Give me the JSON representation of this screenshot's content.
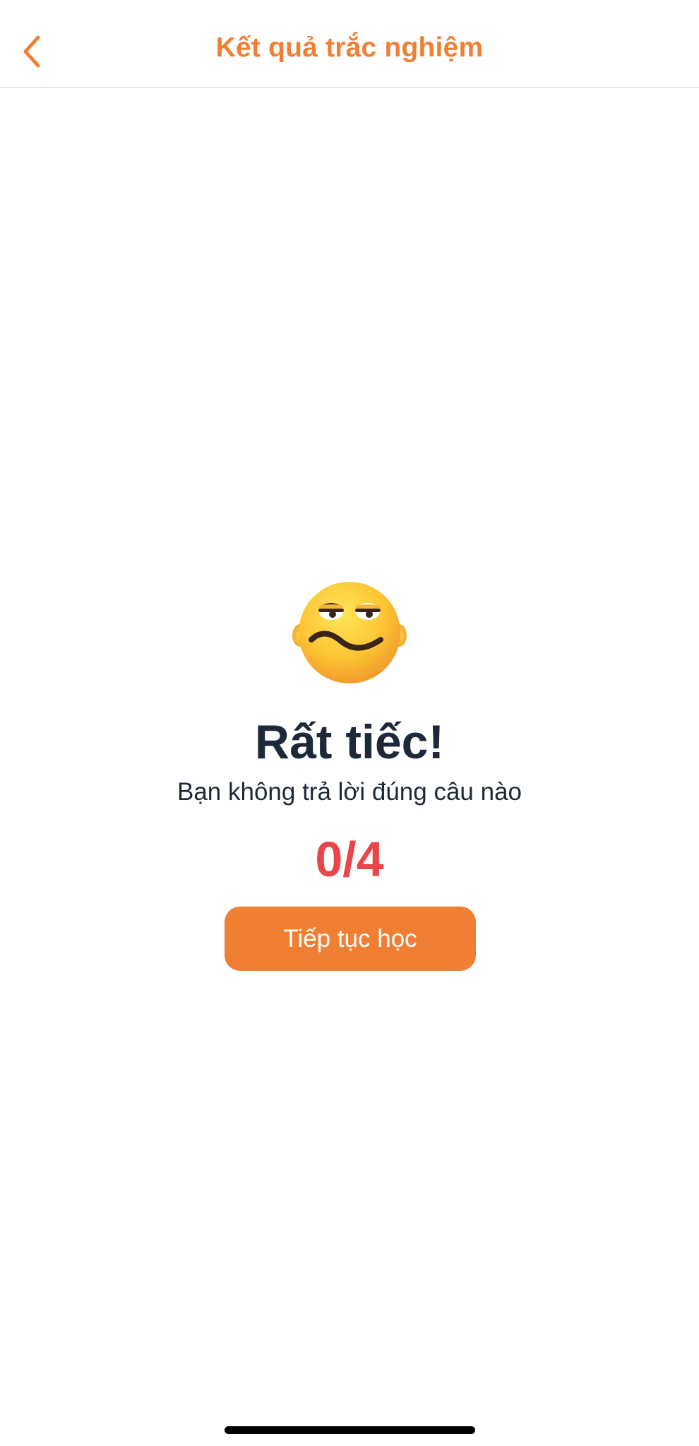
{
  "header": {
    "title": "Kết quả trắc nghiệm",
    "back_icon": "chevron-left-icon"
  },
  "result": {
    "emoji_icon": "unimpressed-face-icon",
    "title": "Rất tiếc!",
    "subtitle": "Bạn không trả lời đúng câu nào",
    "score": "0/4"
  },
  "actions": {
    "continue_label": "Tiếp tục học"
  },
  "colors": {
    "accent": "#f07f34",
    "score": "#e9454a",
    "text_dark": "#1d2838"
  }
}
